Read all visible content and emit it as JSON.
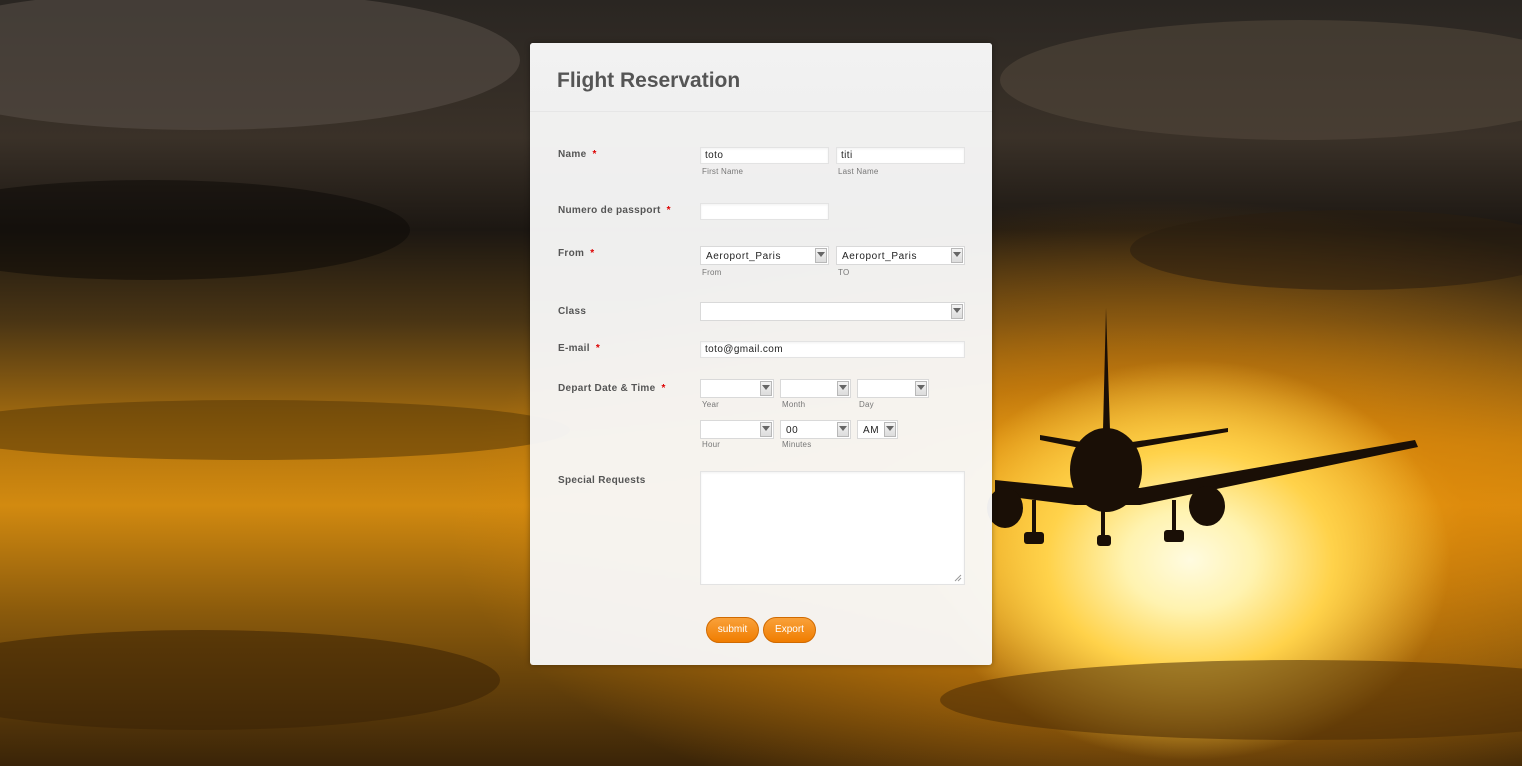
{
  "form": {
    "title": "Flight Reservation",
    "required_mark": "*",
    "name": {
      "label": "Name",
      "first_value": "toto",
      "first_sublabel": "First Name",
      "last_value": "titi",
      "last_sublabel": "Last Name"
    },
    "passport": {
      "label": "Numero de passport",
      "value": ""
    },
    "from": {
      "label": "From",
      "from_value": "Aeroport_Paris",
      "from_sublabel": "From",
      "to_value": "Aeroport_Paris",
      "to_sublabel": "TO"
    },
    "class": {
      "label": "Class",
      "value": ""
    },
    "email": {
      "label": "E-mail",
      "value": "toto@gmail.com"
    },
    "depart": {
      "label": "Depart Date & Time",
      "year_value": "",
      "year_sublabel": "Year",
      "month_value": "",
      "month_sublabel": "Month",
      "day_value": "",
      "day_sublabel": "Day",
      "hour_value": "",
      "hour_sublabel": "Hour",
      "minutes_value": "00",
      "minutes_sublabel": "Minutes",
      "ampm_value": "AM"
    },
    "special": {
      "label": "Special Requests",
      "value": ""
    },
    "buttons": {
      "submit": "submit",
      "export": "Export"
    }
  },
  "colors": {
    "accent_button": "#f07d00",
    "required": "#dd0000",
    "label": "#555555"
  }
}
